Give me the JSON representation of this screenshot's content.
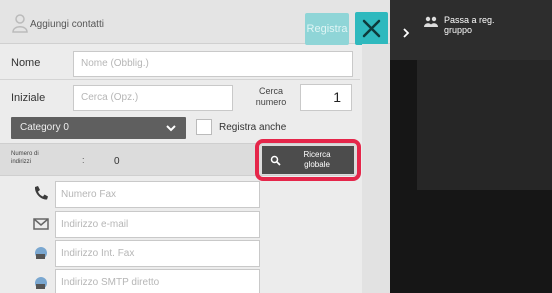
{
  "header": {
    "title": "Aggiungi contatti",
    "register_label": "Registra"
  },
  "form": {
    "nome_label": "Nome",
    "nome_placeholder": "Nome (Obblig.)",
    "iniziale_label": "Iniziale",
    "iniziale_placeholder": "Cerca (Opz.)",
    "cerca_numero_line1": "Cerca",
    "cerca_numero_line2": "numero",
    "cerca_numero_value": "1",
    "category_value": "Category 0",
    "registra_anche_label": "Registra anche",
    "registra_anche_checked": false
  },
  "address_bar": {
    "label_line1": "Numero di",
    "label_line2": "indirizzi",
    "colon": ":",
    "count": "0",
    "search_line1": "Ricerca",
    "search_line2": "globale"
  },
  "contacts": [
    {
      "icon": "phone-icon",
      "placeholder": "Numero Fax"
    },
    {
      "icon": "email-icon",
      "placeholder": "Indirizzo e-mail"
    },
    {
      "icon": "internet-fax-icon",
      "placeholder": "Indirizzo Int. Fax"
    },
    {
      "icon": "smtp-icon",
      "placeholder": "Indirizzo SMTP diretto"
    }
  ],
  "side_panel": {
    "line1": "Passa a reg.",
    "line2": "gruppo"
  },
  "colors": {
    "accent": "#2fb9be",
    "accent_disabled": "#8fd5d7",
    "highlight": "#e5264a",
    "dark_button": "#4c4c4c"
  }
}
